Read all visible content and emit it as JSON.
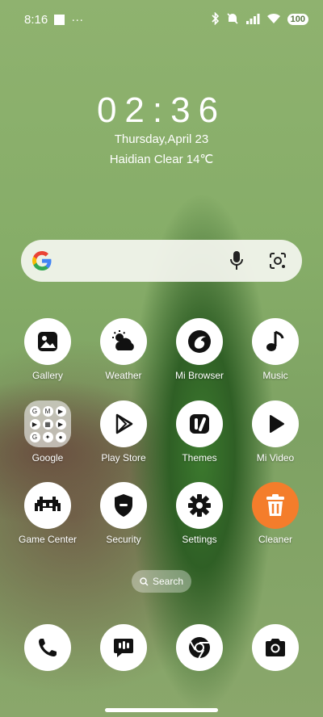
{
  "status": {
    "time": "8:16",
    "overflow": "···",
    "battery": "100"
  },
  "lockscreen": {
    "clock": "02:36",
    "date": "Thursday,April 23",
    "weather": "Haidian Clear 14℃"
  },
  "search_bar": {},
  "apps": [
    {
      "label": "Gallery",
      "icon": "gallery-icon"
    },
    {
      "label": "Weather",
      "icon": "weather-icon"
    },
    {
      "label": "Mi Browser",
      "icon": "browser-icon"
    },
    {
      "label": "Music",
      "icon": "music-icon"
    },
    {
      "label": "Google",
      "icon": "google-folder-icon"
    },
    {
      "label": "Play Store",
      "icon": "play-store-icon"
    },
    {
      "label": "Themes",
      "icon": "themes-icon"
    },
    {
      "label": "Mi Video",
      "icon": "video-icon"
    },
    {
      "label": "Game Center",
      "icon": "game-center-icon"
    },
    {
      "label": "Security",
      "icon": "security-icon"
    },
    {
      "label": "Settings",
      "icon": "gear-icon"
    },
    {
      "label": "Cleaner",
      "icon": "trash-icon"
    }
  ],
  "app_search_label": "Search",
  "dock": [
    {
      "icon": "phone-icon"
    },
    {
      "icon": "messages-icon"
    },
    {
      "icon": "chrome-icon"
    },
    {
      "icon": "camera-icon"
    }
  ],
  "folder_glyphs": [
    "G",
    "M",
    "▶",
    "▶",
    "▦",
    "▶",
    "G",
    "✦",
    "●"
  ],
  "colors": {
    "cleaner_bg": "#f47d2b",
    "icon_fg": "#111111"
  }
}
